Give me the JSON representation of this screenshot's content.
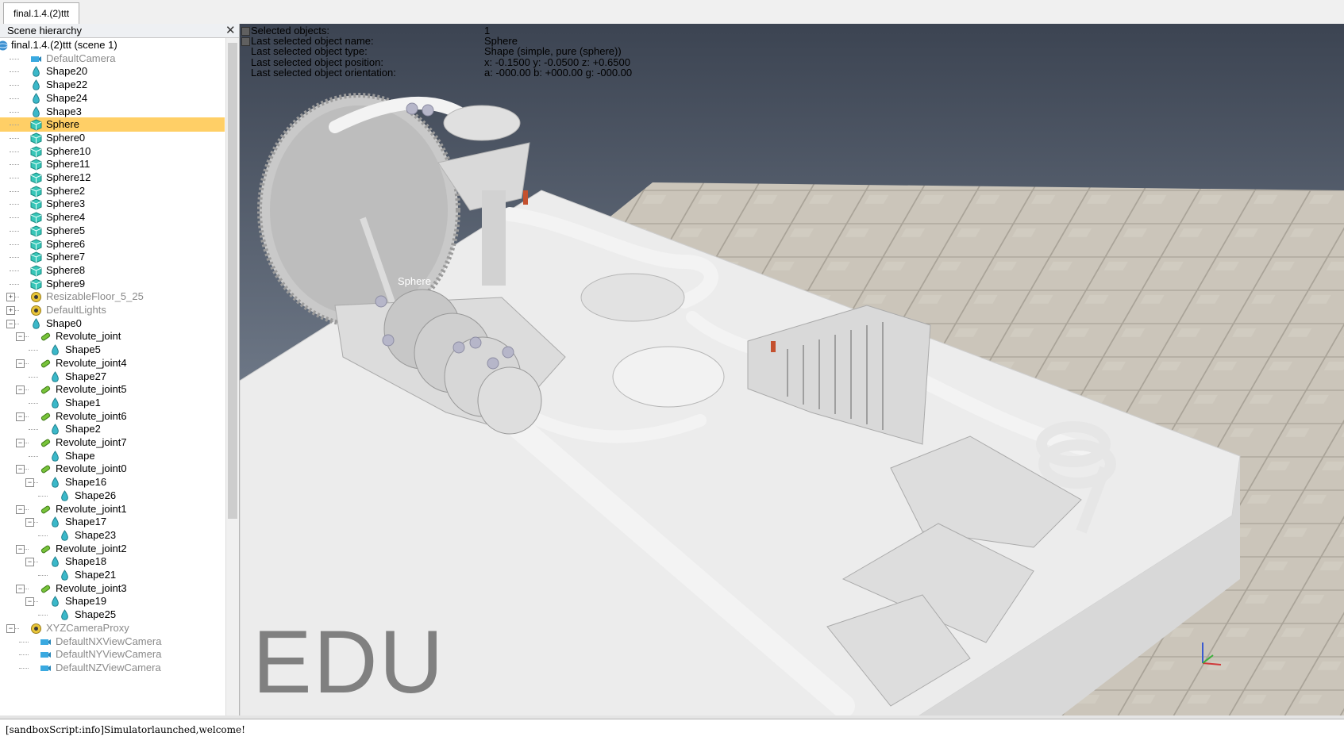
{
  "tab": {
    "label": "final.1.4.(2)ttt"
  },
  "hierarchy": {
    "title": "Scene hierarchy",
    "close_glyph": "✕",
    "nodes": [
      {
        "label": "final.1.4.(2)ttt (scene 1)",
        "icon": "scene-icon",
        "dim": false
      },
      {
        "label": "DefaultCamera",
        "icon": "camera-icon",
        "dim": true
      },
      {
        "label": "Shape20",
        "icon": "shape-icon",
        "dim": false
      },
      {
        "label": "Shape22",
        "icon": "shape-icon",
        "dim": false
      },
      {
        "label": "Shape24",
        "icon": "shape-icon",
        "dim": false
      },
      {
        "label": "Shape3",
        "icon": "shape-icon",
        "dim": false
      },
      {
        "label": "Sphere",
        "icon": "cube-icon",
        "dim": false,
        "selected": true
      },
      {
        "label": "Sphere0",
        "icon": "cube-icon",
        "dim": false
      },
      {
        "label": "Sphere10",
        "icon": "cube-icon",
        "dim": false
      },
      {
        "label": "Sphere11",
        "icon": "cube-icon",
        "dim": false
      },
      {
        "label": "Sphere12",
        "icon": "cube-icon",
        "dim": false
      },
      {
        "label": "Sphere2",
        "icon": "cube-icon",
        "dim": false
      },
      {
        "label": "Sphere3",
        "icon": "cube-icon",
        "dim": false
      },
      {
        "label": "Sphere4",
        "icon": "cube-icon",
        "dim": false
      },
      {
        "label": "Sphere5",
        "icon": "cube-icon",
        "dim": false
      },
      {
        "label": "Sphere6",
        "icon": "cube-icon",
        "dim": false
      },
      {
        "label": "Sphere7",
        "icon": "cube-icon",
        "dim": false
      },
      {
        "label": "Sphere8",
        "icon": "cube-icon",
        "dim": false
      },
      {
        "label": "Sphere9",
        "icon": "cube-icon",
        "dim": false
      },
      {
        "label": "ResizableFloor_5_25",
        "icon": "dummy-icon",
        "dim": true
      },
      {
        "label": "DefaultLights",
        "icon": "dummy-icon",
        "dim": true
      },
      {
        "label": "Shape0",
        "icon": "shape-icon",
        "dim": false
      },
      {
        "label": "Revolute_joint",
        "icon": "joint-icon",
        "dim": false
      },
      {
        "label": "Shape5",
        "icon": "shape-icon",
        "dim": false
      },
      {
        "label": "Revolute_joint4",
        "icon": "joint-icon",
        "dim": false
      },
      {
        "label": "Shape27",
        "icon": "shape-icon",
        "dim": false
      },
      {
        "label": "Revolute_joint5",
        "icon": "joint-icon",
        "dim": false
      },
      {
        "label": "Shape1",
        "icon": "shape-icon",
        "dim": false
      },
      {
        "label": "Revolute_joint6",
        "icon": "joint-icon",
        "dim": false
      },
      {
        "label": "Shape2",
        "icon": "shape-icon",
        "dim": false
      },
      {
        "label": "Revolute_joint7",
        "icon": "joint-icon",
        "dim": false
      },
      {
        "label": "Shape",
        "icon": "shape-icon",
        "dim": false
      },
      {
        "label": "Revolute_joint0",
        "icon": "joint-icon",
        "dim": false
      },
      {
        "label": "Shape16",
        "icon": "shape-icon",
        "dim": false
      },
      {
        "label": "Shape26",
        "icon": "shape-icon",
        "dim": false
      },
      {
        "label": "Revolute_joint1",
        "icon": "joint-icon",
        "dim": false
      },
      {
        "label": "Shape17",
        "icon": "shape-icon",
        "dim": false
      },
      {
        "label": "Shape23",
        "icon": "shape-icon",
        "dim": false
      },
      {
        "label": "Revolute_joint2",
        "icon": "joint-icon",
        "dim": false
      },
      {
        "label": "Shape18",
        "icon": "shape-icon",
        "dim": false
      },
      {
        "label": "Shape21",
        "icon": "shape-icon",
        "dim": false
      },
      {
        "label": "Revolute_joint3",
        "icon": "joint-icon",
        "dim": false
      },
      {
        "label": "Shape19",
        "icon": "shape-icon",
        "dim": false
      },
      {
        "label": "Shape25",
        "icon": "shape-icon",
        "dim": false
      },
      {
        "label": "XYZCameraProxy",
        "icon": "dummy-icon",
        "dim": true
      },
      {
        "label": "DefaultNXViewCamera",
        "icon": "camera-icon",
        "dim": true
      },
      {
        "label": "DefaultNYViewCamera",
        "icon": "camera-icon",
        "dim": true
      },
      {
        "label": "DefaultNZViewCamera",
        "icon": "camera-icon",
        "dim": true
      }
    ]
  },
  "info": {
    "rows": [
      {
        "label": "Selected objects:",
        "value": "1"
      },
      {
        "label": "Last selected object name:",
        "value": "Sphere"
      },
      {
        "label": "Last selected object type:",
        "value": "Shape (simple, pure (sphere))"
      },
      {
        "label": "Last selected object position:",
        "value": "x: -0.1500    y: -0.0500    z: +0.6500"
      },
      {
        "label": "Last selected object orientation:",
        "value": "a: -000.00    b: +000.00    g: -000.00"
      }
    ]
  },
  "viewport": {
    "watermark": "EDU",
    "selected_label": "Sphere",
    "colors": {
      "sky_top": "#3c4452",
      "sky_bottom": "#9aa6b6",
      "floor": "#c9c3b8",
      "model": "#e9e9e9"
    }
  },
  "console": {
    "text": "[sandboxScript:info]Simulatorlaunched,welcome!"
  }
}
